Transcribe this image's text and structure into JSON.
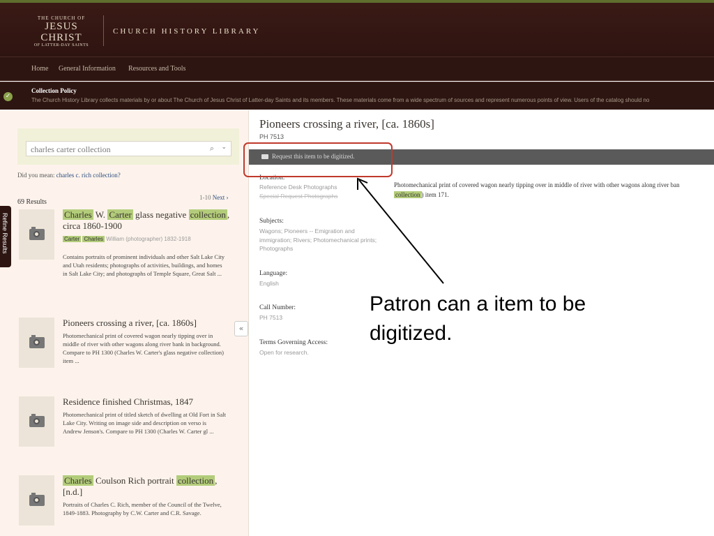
{
  "header": {
    "logo_line1": "THE CHURCH OF",
    "logo_line2": "JESUS CHRIST",
    "logo_line3": "OF LATTER-DAY SAINTS",
    "library_title": "CHURCH HISTORY LIBRARY"
  },
  "nav": {
    "items": [
      "Home",
      "General Information",
      "Resources and Tools"
    ]
  },
  "policy": {
    "title": "Collection Policy",
    "text": "The Church History Library collects materials by or about The Church of Jesus Christ of Latter-day Saints and its members. These materials come from a wide spectrum of sources and represent numerous points of view. Users of the catalog should no"
  },
  "search": {
    "query": "charles carter collection",
    "did_you_mean_label": "Did you mean:",
    "did_you_mean_link": "charles c. rich collection?",
    "results_count": "69 Results",
    "pager_range": "1-10",
    "pager_next": "Next ›",
    "refine_label": "Refine Results"
  },
  "results": [
    {
      "title_parts": [
        {
          "t": "Charles",
          "hl": true
        },
        {
          "t": " W. ",
          "hl": false
        },
        {
          "t": "Carter",
          "hl": true
        },
        {
          "t": " glass negative ",
          "hl": false
        },
        {
          "t": "collection",
          "hl": true
        },
        {
          "t": ", circa 1860-1900",
          "hl": false
        }
      ],
      "tags": [
        {
          "t": "Carter",
          "hl": true
        },
        {
          "t": " ",
          "hl": false
        },
        {
          "t": "Charles",
          "hl": true
        },
        {
          "t": " William (photographer) 1832-1918",
          "hl": false
        }
      ],
      "description": "Contains portraits of prominent individuals and other Salt Lake City and Utah residents; photographs of activities, buildings, and homes in Salt Lake City; and photographs of Temple Square, Great Salt ..."
    },
    {
      "title_parts": [
        {
          "t": "Pioneers crossing a river, [ca. 1860s]",
          "hl": false
        }
      ],
      "tags": [],
      "description": "Photomechanical print of covered wagon nearly tipping over in middle of river with other wagons along river bank in background. Compare to PH 1300 (Charles W. Carter's glass negative collection) item ..."
    },
    {
      "title_parts": [
        {
          "t": "Residence finished Christmas, 1847",
          "hl": false
        }
      ],
      "tags": [],
      "description": "Photomechanical print of titled sketch of dwelling at Old Fort in Salt Lake City. Writing on image side and description on verso is Andrew Jenson's. Compare to PH 1300 (Charles W. Carter gl ..."
    },
    {
      "title_parts": [
        {
          "t": "Charles",
          "hl": true
        },
        {
          "t": " Coulson Rich portrait ",
          "hl": false
        },
        {
          "t": "collection",
          "hl": true
        },
        {
          "t": ", [n.d.]",
          "hl": false
        }
      ],
      "tags": [],
      "description": "Portraits of Charles C. Rich, member of the Council of the Twelve, 1849-1883. Photography by C.W. Carter and C.R. Savage."
    }
  ],
  "detail": {
    "title": "Pioneers crossing a river, [ca. 1860s]",
    "call_number_top": "PH 7513",
    "request_text": "Request this item to be digitized.",
    "location_label": "Location:",
    "location_value1": "Reference Desk Photographs",
    "location_value2": "Special Request Photographs",
    "subjects_label": "Subjects:",
    "subjects_value": "Wagons; Pioneers -- Emigration and immigration; Rivers; Photomechanical prints; Photographs",
    "language_label": "Language:",
    "language_value": "English",
    "callnum_label": "Call Number:",
    "callnum_value": "PH 7513",
    "terms_label": "Terms Governing Access:",
    "terms_value": "Open for research.",
    "desc_line1": "Photomechanical print of covered wagon nearly tipping over in middle of river with other wagons along river ban",
    "desc_hl": "collection",
    "desc_line2_tail": ") item 171."
  },
  "annotation": {
    "text": "Patron can a item to be digitized.",
    "color": "#c0392b"
  },
  "icons": {
    "policy": "check-icon",
    "search": "search-icon",
    "dropdown": "chevron-down-icon",
    "collapse": "double-chevron-left-icon",
    "thumb": "camera-icon"
  }
}
